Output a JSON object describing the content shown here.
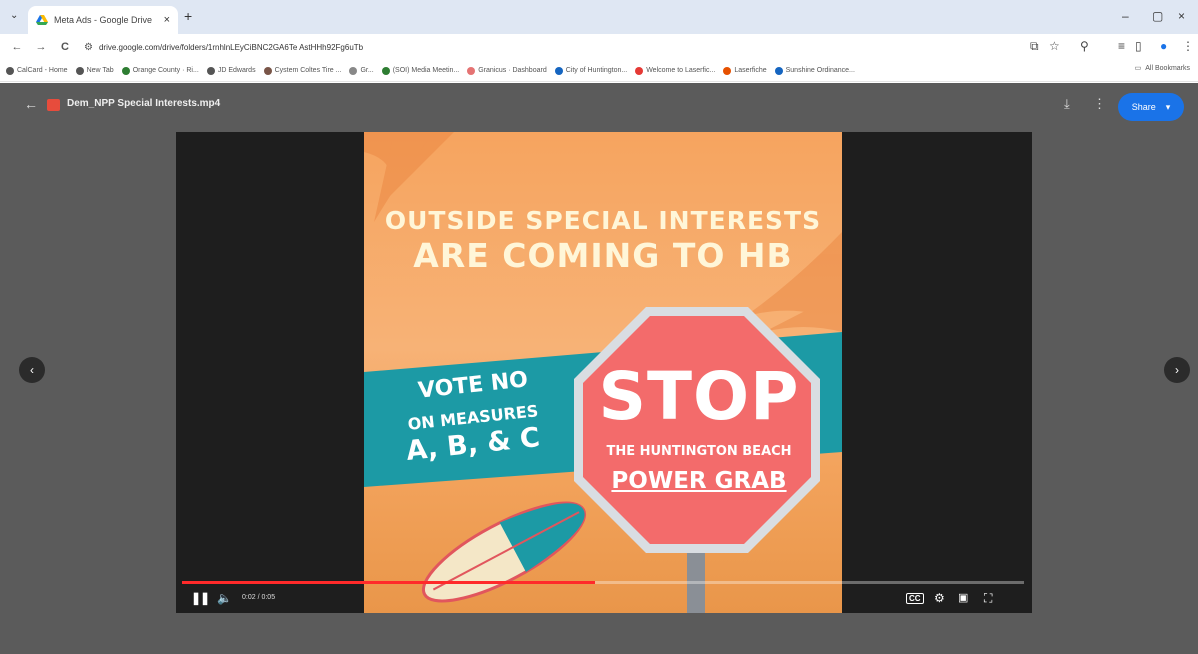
{
  "browser": {
    "tab_title": "Meta Ads - Google Drive",
    "tab_close": "×",
    "tab_menu": "⌄",
    "new_tab": "+",
    "window_controls": [
      "–",
      "▢",
      "×"
    ],
    "url": "drive.google.com/drive/folders/1rnhlnLEyCiBNC2GA6Te AstHHh92Fg6uTb",
    "nav": {
      "back": "←",
      "forward": "→",
      "reload": "C"
    },
    "bookmarks": [
      {
        "label": "CalCard - Home",
        "color": "#555555"
      },
      {
        "label": "New Tab",
        "color": "#555555"
      },
      {
        "label": "Orange County · Ri...",
        "color": "#2e7d32"
      },
      {
        "label": "JD Edwards",
        "color": "#555555"
      },
      {
        "label": "Cystem Coltes Tire ...",
        "color": "#795548"
      },
      {
        "label": "Gr...",
        "color": "#888888"
      },
      {
        "label": "(SOI) Media Meetin...",
        "color": "#2e7d32"
      },
      {
        "label": "Granicus · Dashboard",
        "color": "#e57373"
      },
      {
        "label": "City of Huntington...",
        "color": "#1565c0"
      },
      {
        "label": "Welcome to Laserfic...",
        "color": "#e53935"
      },
      {
        "label": "Laserfiche",
        "color": "#e65100"
      },
      {
        "label": "Sunshine Ordinance...",
        "color": "#1565c0"
      }
    ],
    "all_bookmarks": "All Bookmarks"
  },
  "viewer": {
    "file_name": "Dem_NPP Special Interests.mp4",
    "share_label": "Share",
    "share_caret": "▾",
    "prev": "‹",
    "next": "›"
  },
  "video": {
    "headline_1": "OUTSIDE SPECIAL INTERESTS",
    "headline_2": "ARE COMING TO HB",
    "vote_1": "VOTE NO",
    "vote_2": "ON MEASURES",
    "vote_3": "A, B, & C",
    "stop_word": "STOP",
    "stop_line_1": "THE HUNTINGTON BEACH",
    "stop_line_2": "POWER GRAB",
    "time": "0:02 / 0:05",
    "progress_fraction": 0.49,
    "buffer_fraction": 0.49,
    "accent_color": "#ff2a2a",
    "banner_color": "#1c9aa5",
    "sign_color": "#f36b6b"
  },
  "icons": {
    "download": "⤓",
    "more": "⋮",
    "pause": "❚❚",
    "volume": "🔈",
    "cc": "CC",
    "settings": "⚙",
    "miniplayer": "▣",
    "fullscreen": "⛶"
  }
}
